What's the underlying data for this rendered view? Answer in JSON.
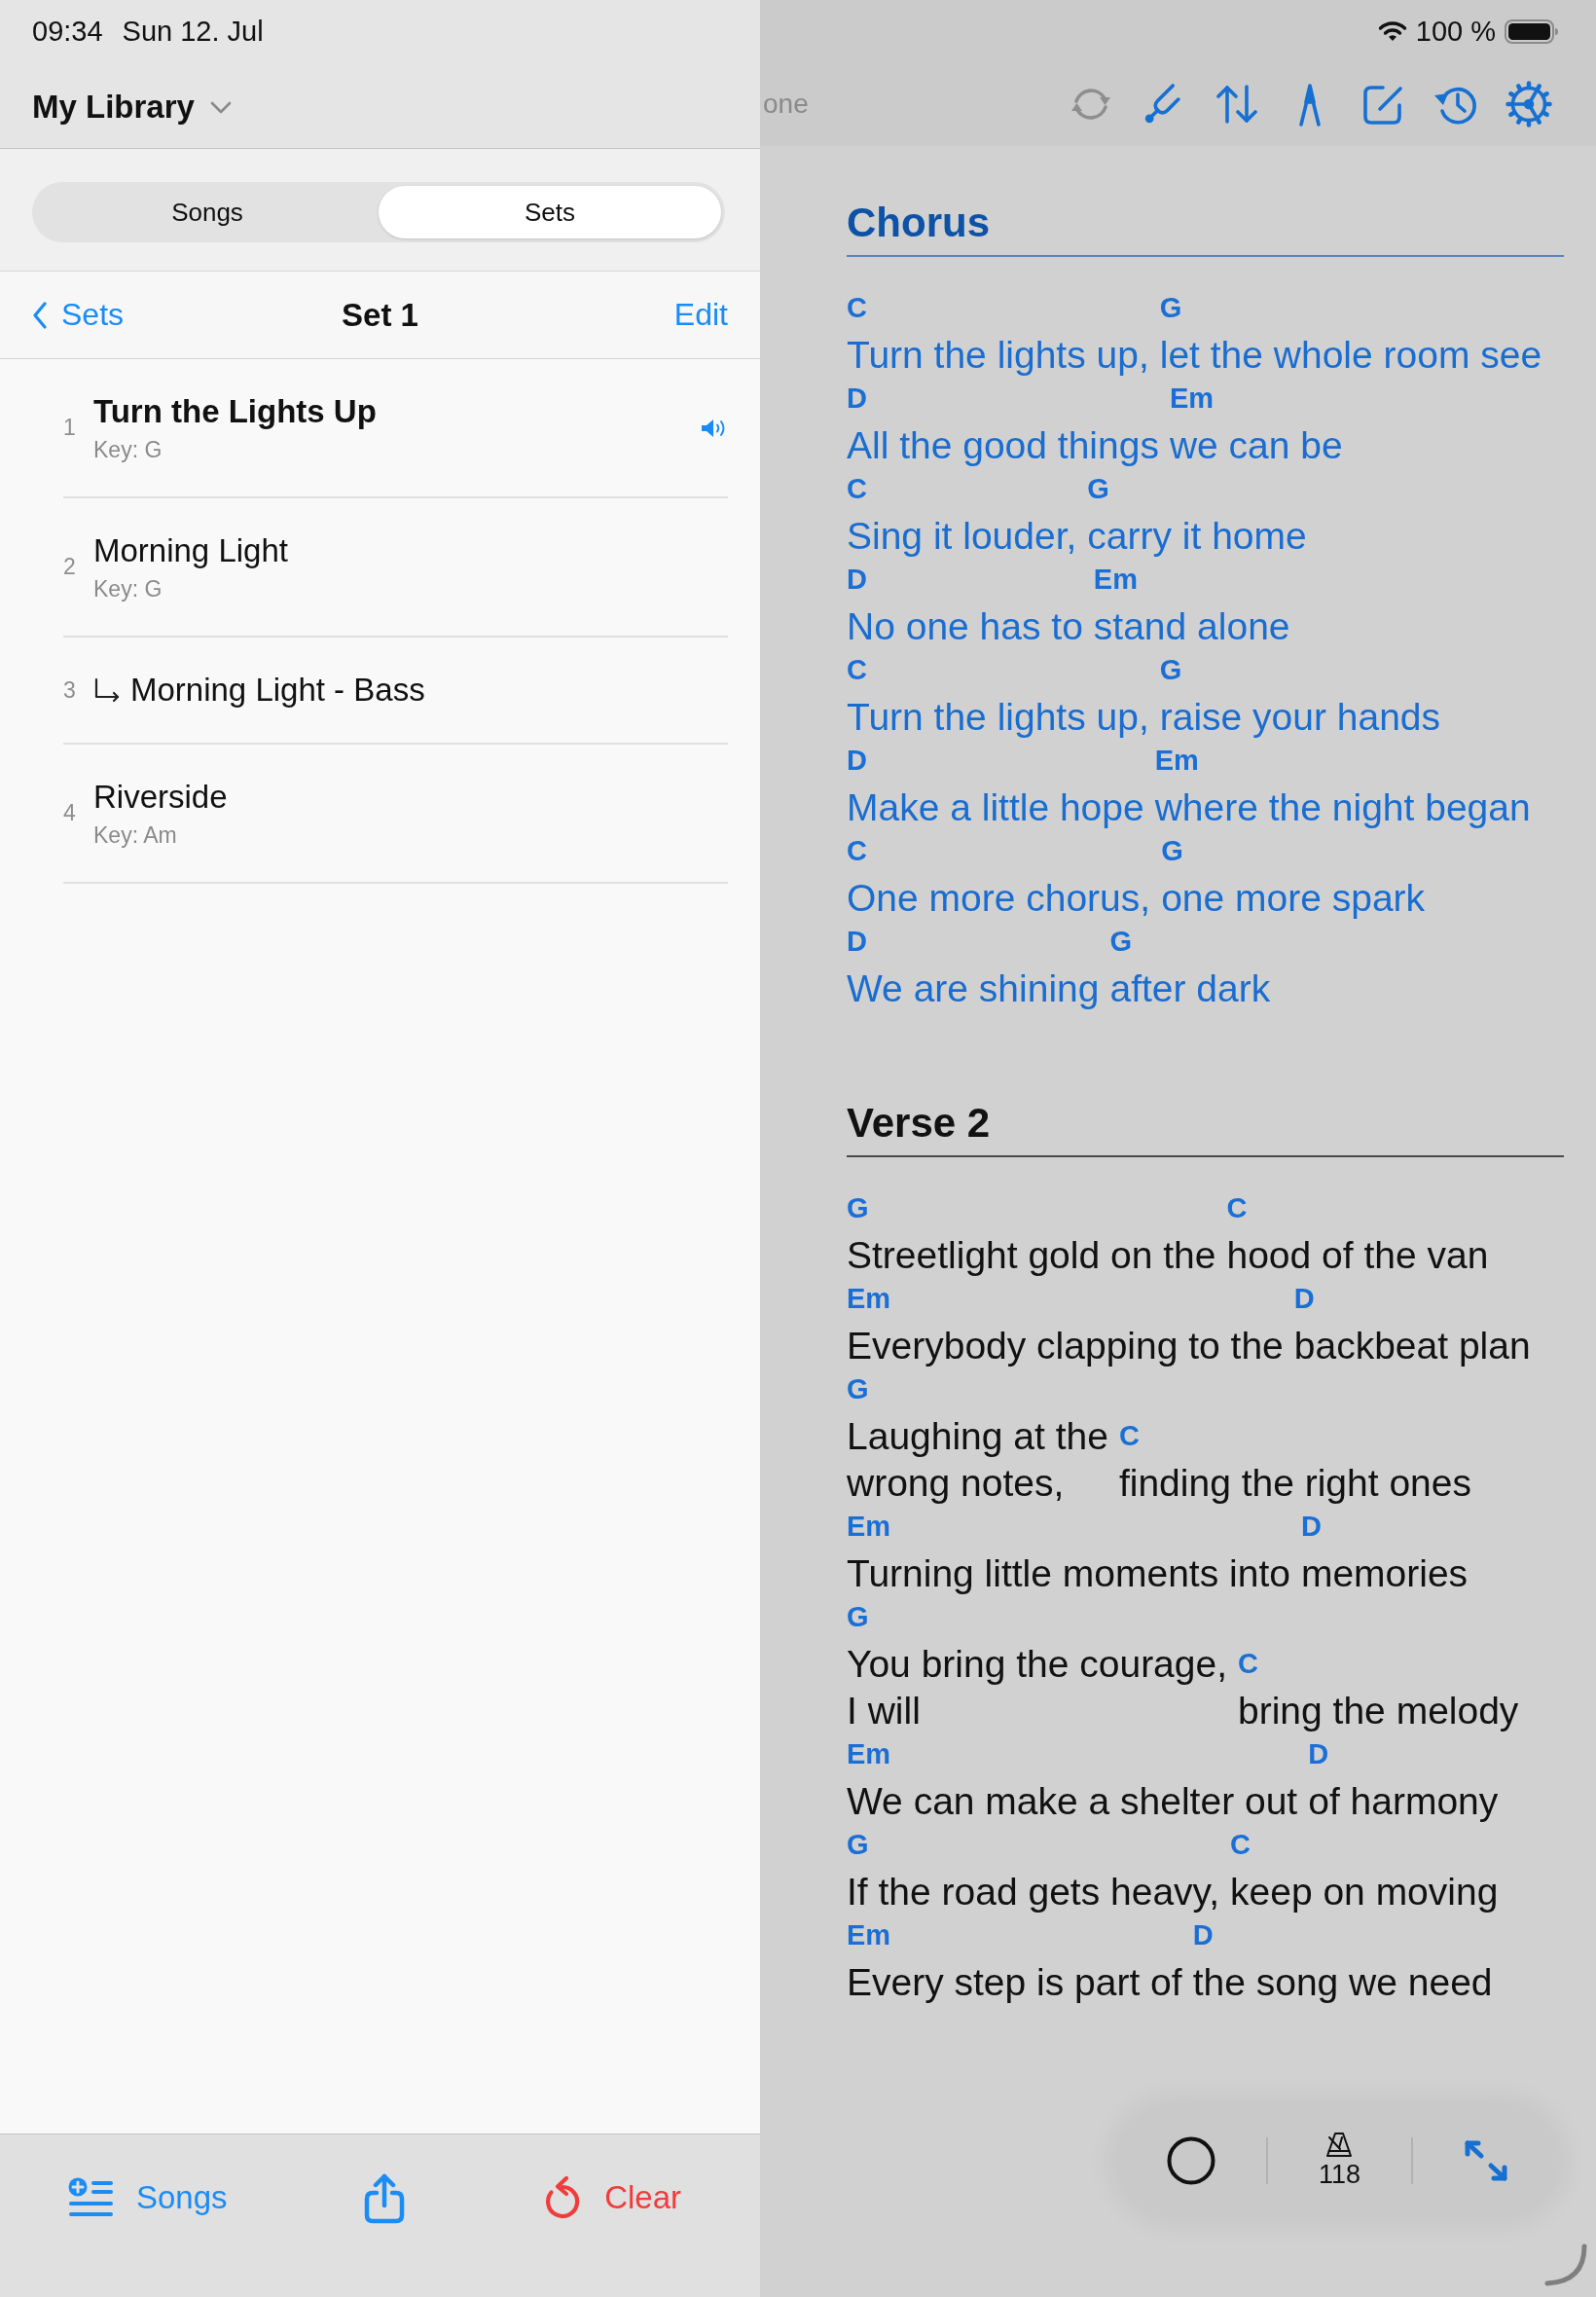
{
  "status_bar": {
    "time": "09:34",
    "date": "Sun 12. Jul",
    "battery": "100 %"
  },
  "sidebar": {
    "library": "My Library",
    "segments": [
      {
        "label": "Songs",
        "selected": false
      },
      {
        "label": "Sets",
        "selected": true
      }
    ],
    "nav": {
      "back": "Sets",
      "title": "Set 1",
      "action": "Edit"
    },
    "items": [
      {
        "number": "1",
        "kind": "song",
        "title": "Turn the Lights Up",
        "key": "Key: G",
        "selected": true
      },
      {
        "number": "2",
        "kind": "song",
        "title": "Morning Light",
        "key": "Key: G",
        "selected": false
      },
      {
        "number": "3",
        "kind": "variant",
        "title": "Morning Light - Bass",
        "selected": false
      },
      {
        "number": "4",
        "kind": "song",
        "title": "Riverside",
        "key": "Key: Am",
        "selected": false
      }
    ],
    "bottom_bar": [
      {
        "kind": "add",
        "label": "Songs"
      },
      {
        "kind": "share"
      },
      {
        "kind": "clear",
        "label": "Clear"
      }
    ]
  },
  "toolbar": {
    "button_text": "one",
    "buttons": [
      {
        "kind": "sync",
        "disabled": true
      },
      {
        "kind": "tuning-fork",
        "disabled": false
      },
      {
        "kind": "transpose",
        "disabled": false
      },
      {
        "kind": "nib",
        "disabled": false
      },
      {
        "kind": "edit",
        "disabled": false
      },
      {
        "kind": "history",
        "disabled": false
      },
      {
        "kind": "settings",
        "disabled": false
      }
    ]
  },
  "sheet": {
    "sections": [
      {
        "kind": "chorus",
        "title": "Chorus",
        "lines": [
          {
            "segments": [
              {
                "chord": "C",
                "text": "Turn the lights up,"
              },
              {
                "chord": "G",
                "text": "let the whole room see"
              }
            ]
          },
          {
            "segments": [
              {
                "chord": "D",
                "text": "All the good things"
              },
              {
                "chord": "Em",
                "text": "we can be"
              }
            ]
          },
          {
            "segments": [
              {
                "chord": "C",
                "text": "Sing it louder,"
              },
              {
                "chord": "G",
                "text": "carry it home"
              }
            ]
          },
          {
            "segments": [
              {
                "chord": "D",
                "text": "No one has to"
              },
              {
                "chord": "Em",
                "text": "stand alone"
              }
            ]
          },
          {
            "segments": [
              {
                "chord": "C",
                "text": "Turn the lights up,"
              },
              {
                "chord": "G",
                "text": "raise your hands"
              }
            ]
          },
          {
            "segments": [
              {
                "chord": "D",
                "text": "Make a little hope"
              },
              {
                "chord": "Em",
                "text": "where the night began"
              }
            ]
          },
          {
            "segments": [
              {
                "chord": "C",
                "text": "One more chorus,"
              },
              {
                "chord": "G",
                "text": "one more spark"
              }
            ]
          },
          {
            "segments": [
              {
                "chord": "D",
                "text": "We are shining"
              },
              {
                "chord": "G",
                "text": "after dark"
              }
            ]
          }
        ]
      },
      {
        "kind": "verse",
        "title": "Verse 2",
        "lines": [
          {
            "segments": [
              {
                "chord": "G",
                "text": "Streetlight gold on the"
              },
              {
                "chord": "C",
                "text": "hood of the van"
              }
            ]
          },
          {
            "segments": [
              {
                "chord": "Em",
                "text": "Everybody clapping to the"
              },
              {
                "chord": "D",
                "text": "backbeat plan"
              }
            ]
          },
          {
            "segments": [
              {
                "chord": "G",
                "lines": [
                  "Laughing at the",
                  "wrong notes,"
                ]
              },
              {
                "chord": "C",
                "text": "finding the right ones"
              }
            ]
          },
          {
            "segments": [
              {
                "chord": "Em",
                "text": "Turning little moments into"
              },
              {
                "chord": "D",
                "text": "memories"
              }
            ]
          },
          {
            "segments": [
              {
                "chord": "G",
                "lines": [
                  "You bring the courage,",
                  "I will"
                ]
              },
              {
                "chord": "C",
                "text": "bring the melody"
              }
            ]
          },
          {
            "segments": [
              {
                "chord": "Em",
                "text": "We can make a shelter out"
              },
              {
                "chord": "D",
                "text": "of harmony"
              }
            ]
          },
          {
            "segments": [
              {
                "chord": "G",
                "text": "If the road gets heavy,"
              },
              {
                "chord": "C",
                "text": "keep on moving"
              }
            ]
          },
          {
            "segments": [
              {
                "chord": "Em",
                "text": "Every step is part of"
              },
              {
                "chord": "D",
                "text": "the song we need"
              }
            ]
          }
        ]
      }
    ]
  },
  "float_bar": [
    {
      "kind": "record"
    },
    {
      "kind": "metronome",
      "label": "118"
    },
    {
      "kind": "expand"
    }
  ]
}
